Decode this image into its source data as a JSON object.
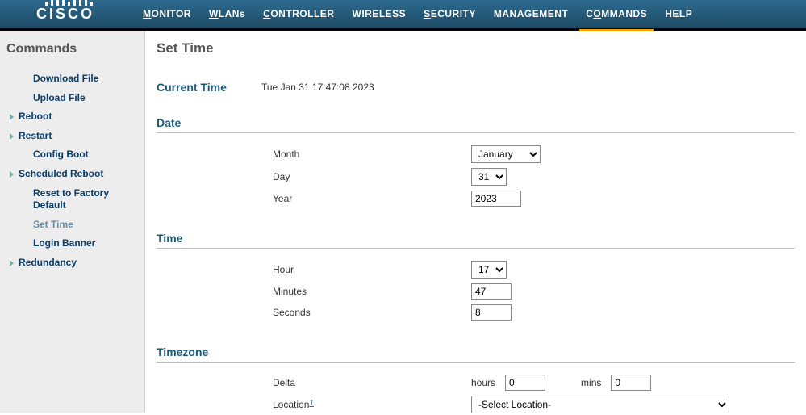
{
  "brand": "CISCO",
  "nav": {
    "monitor": "MONITOR",
    "wlans": "WLANs",
    "controller": "CONTROLLER",
    "wireless": "WIRELESS",
    "security": "SECURITY",
    "management": "MANAGEMENT",
    "commands": "COMMANDS",
    "help": "HELP"
  },
  "sidebar": {
    "title": "Commands",
    "download_file": "Download File",
    "upload_file": "Upload File",
    "reboot": "Reboot",
    "restart": "Restart",
    "config_boot": "Config Boot",
    "scheduled_reboot": "Scheduled Reboot",
    "reset_factory": "Reset to Factory Default",
    "set_time": "Set Time",
    "login_banner": "Login Banner",
    "redundancy": "Redundancy"
  },
  "page": {
    "title": "Set Time",
    "current_time_label": "Current Time",
    "current_time_value": "Tue Jan 31 17:47:08 2023",
    "date_header": "Date",
    "time_header": "Time",
    "timezone_header": "Timezone",
    "labels": {
      "month": "Month",
      "day": "Day",
      "year": "Year",
      "hour": "Hour",
      "minutes": "Minutes",
      "seconds": "Seconds",
      "delta": "Delta",
      "location": "Location",
      "hours": "hours",
      "mins": "mins"
    },
    "values": {
      "month": "January",
      "day": "31",
      "year": "2023",
      "hour": "17",
      "minutes": "47",
      "seconds": "8",
      "delta_hours": "0",
      "delta_mins": "0",
      "location": "-Select Location-"
    },
    "footnote": "1"
  }
}
